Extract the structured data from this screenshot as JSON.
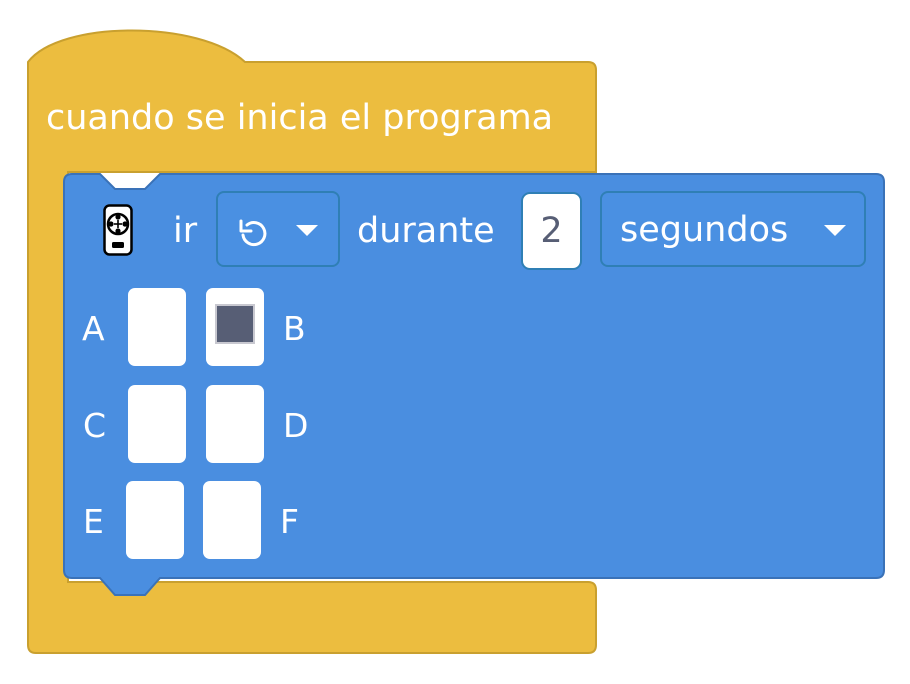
{
  "hat_block": {
    "label": "cuando se inicia el programa",
    "color": "#ecbd3f"
  },
  "motor_block": {
    "color": "#4a8ee0",
    "icon": "motor-icon",
    "go_label": "ir",
    "direction_dropdown": {
      "icon": "rotate-counterclockwise-icon",
      "selected": "counterclockwise"
    },
    "during_label": "durante",
    "duration_value": "2",
    "unit_dropdown": {
      "selected": "segundos"
    },
    "ports": [
      {
        "label": "A",
        "selected": false
      },
      {
        "label": "B",
        "selected": true
      },
      {
        "label": "C",
        "selected": false
      },
      {
        "label": "D",
        "selected": false
      },
      {
        "label": "E",
        "selected": false
      },
      {
        "label": "F",
        "selected": false
      }
    ]
  }
}
